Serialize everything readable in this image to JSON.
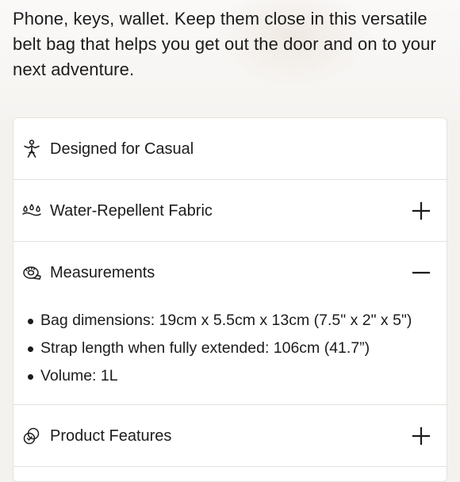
{
  "description": "Phone, keys, wallet. Keep them close in this versatile belt bag that helps you get out the door and on to your next adventure.",
  "accordion": {
    "items": [
      {
        "label": "Designed for Casual",
        "icon": "person-activity-icon",
        "toggle": "none"
      },
      {
        "label": "Water-Repellent Fabric",
        "icon": "water-drops-icon",
        "toggle": "plus-icon"
      },
      {
        "label": "Measurements",
        "icon": "tape-measure-icon",
        "toggle": "minus-icon",
        "expanded": true
      },
      {
        "label": "Product Features",
        "icon": "features-icon",
        "toggle": "plus-icon"
      }
    ],
    "measurements": [
      "Bag dimensions: 19cm x 5.5cm x 13cm (7.5\" x 2\" x 5\")",
      "Strap length when fully extended: 106cm (41.7”)",
      "Volume: 1L"
    ]
  },
  "colors": {
    "text": "#1c1c1c",
    "divider": "#e4e1dd",
    "card": "#ffffff",
    "page_bg": "#f4f2ef"
  }
}
